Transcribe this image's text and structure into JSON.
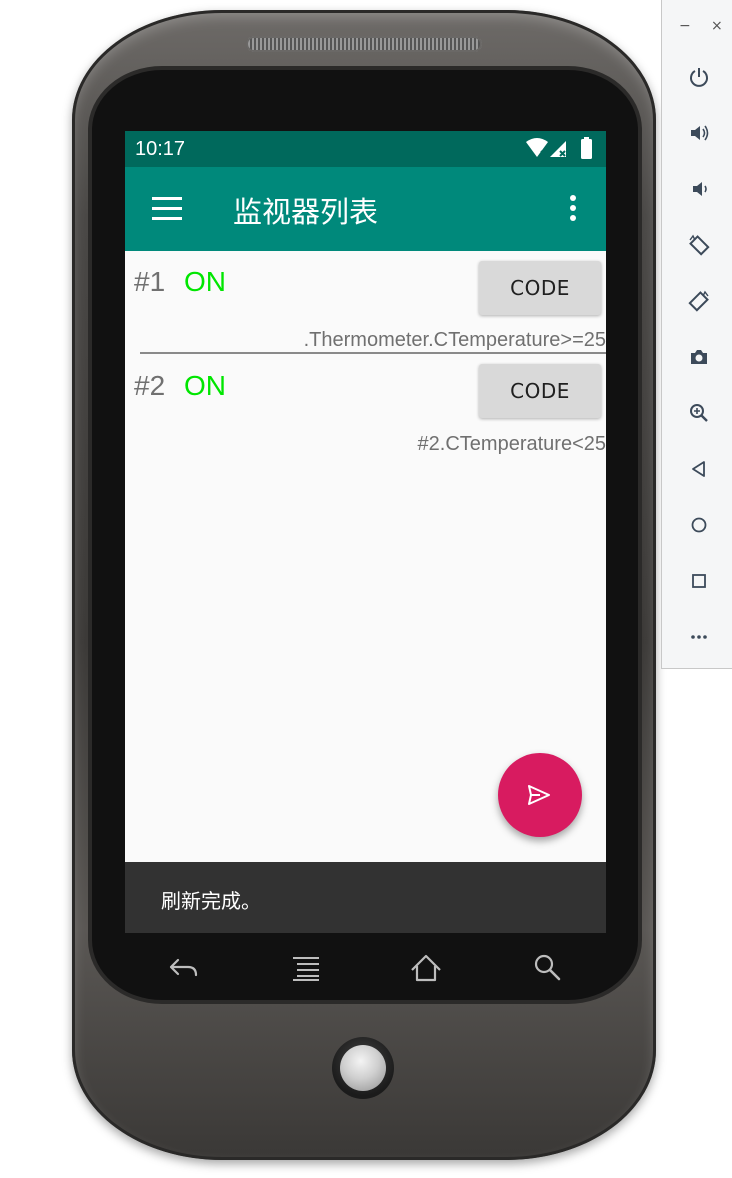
{
  "status_bar": {
    "time": "10:17"
  },
  "app_bar": {
    "title": "监视器列表"
  },
  "monitors": [
    {
      "index": "#1",
      "state": "ON",
      "button": "CODE",
      "expression": ".Thermometer.CTemperature>=25"
    },
    {
      "index": "#2",
      "state": "ON",
      "button": "CODE",
      "expression": "#2.CTemperature<25"
    }
  ],
  "snackbar": {
    "message": "刷新完成。"
  },
  "fab": {
    "icon": "send-icon"
  },
  "colors": {
    "status_bar": "#00695c",
    "app_bar": "#00897b",
    "state_on": "#00e600",
    "fab": "#d81b60",
    "snackbar": "#323232"
  },
  "nav_keys": [
    "back-icon",
    "menu-icon",
    "home-icon",
    "search-icon"
  ],
  "emulator_toolbar": {
    "window_buttons": [
      "−",
      "×"
    ],
    "icons": [
      "power-icon",
      "volume-up-icon",
      "volume-down-icon",
      "rotate-left-icon",
      "rotate-right-icon",
      "camera-icon",
      "zoom-icon",
      "back-icon",
      "home-icon",
      "overview-icon",
      "more-icon"
    ]
  }
}
